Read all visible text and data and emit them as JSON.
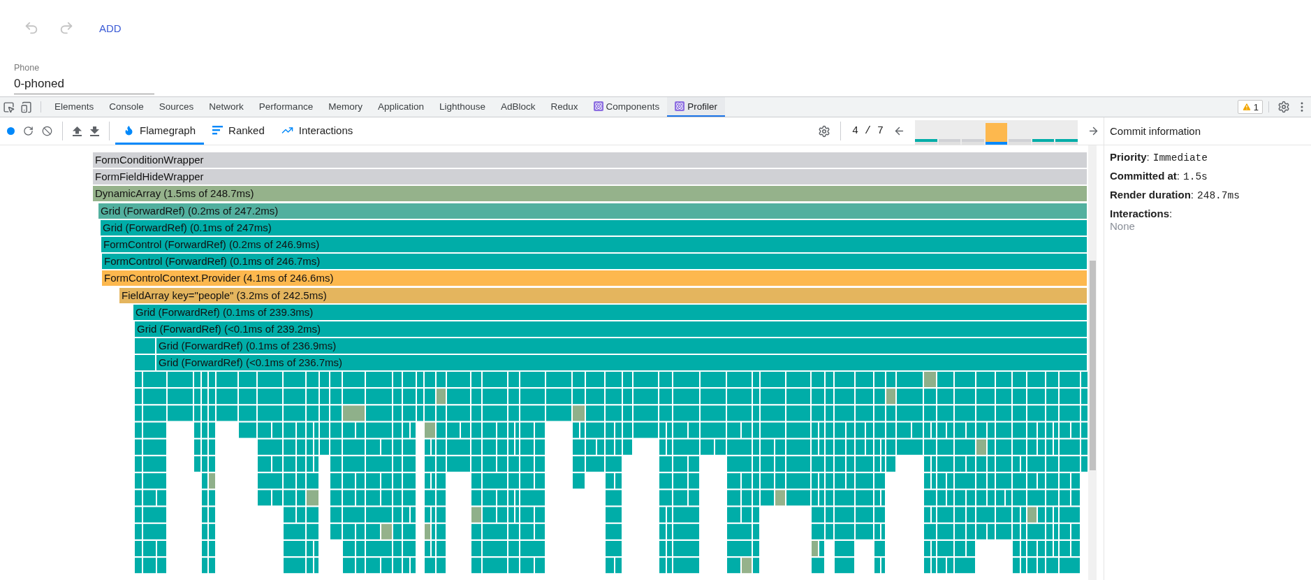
{
  "app_toolbar": {
    "undo": {
      "disabled": true
    },
    "redo": {
      "disabled": true
    },
    "add_label": "ADD"
  },
  "phone_field": {
    "label": "Phone",
    "value": "0-phoned"
  },
  "devtools_tabs": [
    {
      "label": "Elements",
      "selected": false,
      "kind": "plain"
    },
    {
      "label": "Console",
      "selected": false,
      "kind": "plain"
    },
    {
      "label": "Sources",
      "selected": false,
      "kind": "plain"
    },
    {
      "label": "Network",
      "selected": false,
      "kind": "plain"
    },
    {
      "label": "Performance",
      "selected": false,
      "kind": "plain"
    },
    {
      "label": "Memory",
      "selected": false,
      "kind": "plain"
    },
    {
      "label": "Application",
      "selected": false,
      "kind": "plain"
    },
    {
      "label": "Lighthouse",
      "selected": false,
      "kind": "plain"
    },
    {
      "label": "AdBlock",
      "selected": false,
      "kind": "plain"
    },
    {
      "label": "Redux",
      "selected": false,
      "kind": "plain"
    },
    {
      "label": "Components",
      "selected": false,
      "kind": "react"
    },
    {
      "label": "Profiler",
      "selected": true,
      "kind": "react"
    }
  ],
  "warning_badge": {
    "count": "1"
  },
  "view_tabs": [
    {
      "label": "Flamegraph",
      "selected": true,
      "kind": "flame"
    },
    {
      "label": "Ranked",
      "selected": false,
      "kind": "ranked"
    },
    {
      "label": "Interactions",
      "selected": false,
      "kind": "interactions"
    }
  ],
  "commit_position": "4 / 7",
  "commits": [
    {
      "color": "#00ada8",
      "selected": false
    },
    {
      "color": "#d0d1d5",
      "selected": false
    },
    {
      "color": "#d0d1d5",
      "selected": false
    },
    {
      "color": "#fdb84e",
      "selected": true
    },
    {
      "color": "#d0d1d5",
      "selected": false
    },
    {
      "color": "#00ada8",
      "selected": false
    },
    {
      "color": "#00ada8",
      "selected": false
    }
  ],
  "flamegraph_rows": [
    {
      "label": "FormConditionWrapper",
      "color": "#d0d1d5",
      "kind": "bar"
    },
    {
      "label": "FormFieldHideWrapper",
      "color": "#d0d1d5",
      "kind": "bar"
    },
    {
      "label": "DynamicArray (1.5ms of 248.7ms)",
      "color": "#95b28b",
      "kind": "bar"
    },
    {
      "label": "Grid (ForwardRef) (0.2ms of 247.2ms)",
      "color": "#52b09f",
      "kind": "bar"
    },
    {
      "label": "Grid (ForwardRef) (0.1ms of 247ms)",
      "color": "#00ada8",
      "kind": "bar"
    },
    {
      "label": "FormControl (ForwardRef) (0.2ms of 246.9ms)",
      "color": "#00ada8",
      "kind": "bar"
    },
    {
      "label": "FormControl (ForwardRef) (0.1ms of 246.7ms)",
      "color": "#00ada8",
      "kind": "bar"
    },
    {
      "label": "FormControlContext.Provider (4.1ms of 246.6ms)",
      "color": "#fdb84e",
      "kind": "bar"
    },
    {
      "label": "FieldArray key=\"people\" (3.2ms of 242.5ms)",
      "color": "#e4b55e",
      "kind": "bar"
    },
    {
      "label": "Grid (ForwardRef) (0.1ms of 239.3ms)",
      "color": "#00ada8",
      "kind": "bar"
    },
    {
      "label": "Grid (ForwardRef) (<0.1ms of 239.2ms)",
      "color": "#00ada8",
      "kind": "bar"
    },
    {
      "label": "Grid (ForwardRef) (0.1ms of 236.9ms)",
      "color": "#00ada8",
      "kind": "split"
    },
    {
      "label": "Grid (ForwardRef) (<0.1ms of 236.7ms)",
      "color": "#00ada8",
      "kind": "split"
    }
  ],
  "commit_info": {
    "title": "Commit information",
    "fields": [
      {
        "label": "**Priority**:",
        "value": "Immediate"
      },
      {
        "label": "**Committed at**:",
        "value": "1.5s"
      },
      {
        "label": "**Render duration**:",
        "value": "248.7ms"
      }
    ],
    "interactions": {
      "label": "**Interactions**:",
      "value": "None"
    }
  }
}
